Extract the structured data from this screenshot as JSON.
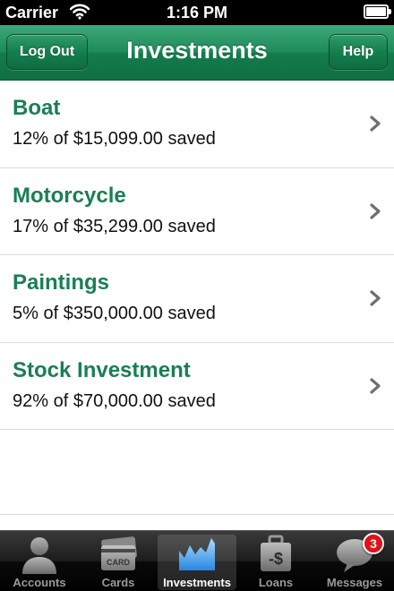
{
  "status_bar": {
    "carrier": "Carrier",
    "time": "1:16 PM"
  },
  "nav": {
    "title": "Investments",
    "left_button": "Log Out",
    "right_button": "Help"
  },
  "investments": [
    {
      "name": "Boat",
      "detail": "12% of $15,099.00 saved"
    },
    {
      "name": "Motorcycle",
      "detail": "17% of $35,299.00 saved"
    },
    {
      "name": "Paintings",
      "detail": "5% of $350,000.00 saved"
    },
    {
      "name": "Stock Investment",
      "detail": "92% of $70,000.00 saved"
    }
  ],
  "tabs": [
    {
      "label": "Accounts",
      "icon": "person-icon"
    },
    {
      "label": "Cards",
      "icon": "card-icon",
      "icon_text": "CARD"
    },
    {
      "label": "Investments",
      "icon": "chart-icon",
      "active": true
    },
    {
      "label": "Loans",
      "icon": "briefcase-dollar-icon",
      "icon_text": "-$"
    },
    {
      "label": "Messages",
      "icon": "speech-bubble-icon",
      "badge": "3"
    }
  ],
  "colors": {
    "accent_green": "#1a7f54",
    "nav_green": "#137c4c",
    "badge_red": "#e0121b"
  }
}
